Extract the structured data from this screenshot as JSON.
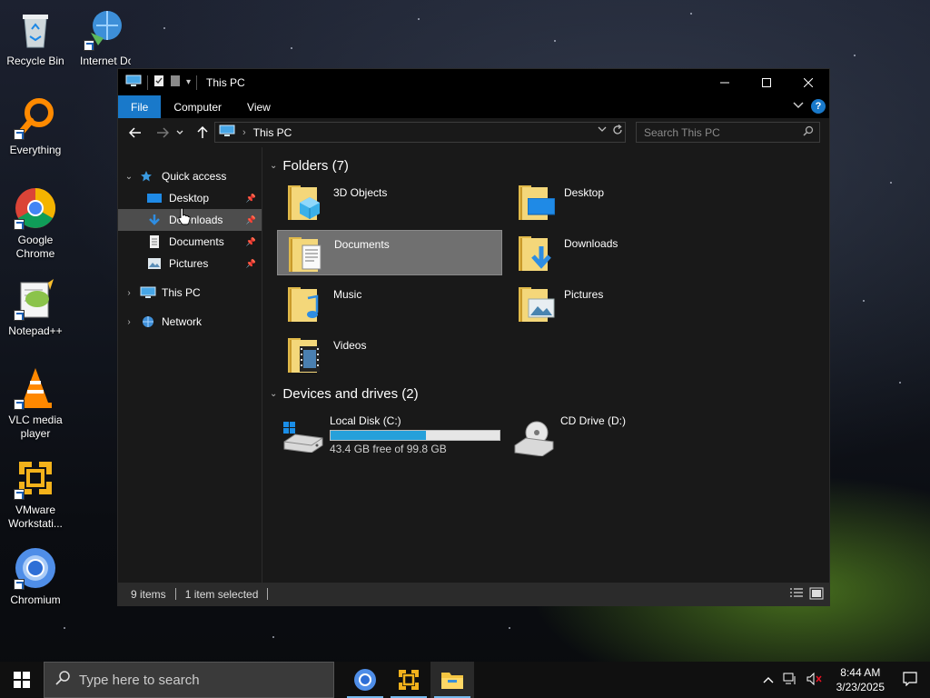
{
  "desktop": {
    "icons": [
      {
        "label": "Recycle Bin"
      },
      {
        "label": "Internet Downl"
      },
      {
        "label": "Everything"
      },
      {
        "label": "Google Chrome"
      },
      {
        "label": "Notepad++"
      },
      {
        "label": "VLC media player"
      },
      {
        "label": "VMware Workstati..."
      },
      {
        "label": "Chromium"
      }
    ]
  },
  "window": {
    "title": "This PC",
    "ribbon": {
      "tabs": [
        {
          "label": "File"
        },
        {
          "label": "Computer"
        },
        {
          "label": "View"
        }
      ]
    },
    "address": {
      "location": "This PC"
    },
    "search": {
      "placeholder": "Search This PC"
    },
    "nav": {
      "quick_access": "Quick access",
      "pinned": [
        {
          "label": "Desktop"
        },
        {
          "label": "Downloads"
        },
        {
          "label": "Documents"
        },
        {
          "label": "Pictures"
        }
      ],
      "this_pc": "This PC",
      "network": "Network"
    },
    "content": {
      "folders_heading": "Folders (7)",
      "folders": [
        {
          "name": "3D Objects"
        },
        {
          "name": "Desktop"
        },
        {
          "name": "Documents"
        },
        {
          "name": "Downloads"
        },
        {
          "name": "Music"
        },
        {
          "name": "Pictures"
        },
        {
          "name": "Videos"
        }
      ],
      "drives_heading": "Devices and drives (2)",
      "drives": [
        {
          "name": "Local Disk (C:)",
          "free_text": "43.4 GB free of 99.8 GB",
          "used_fraction": 0.565
        },
        {
          "name": "CD Drive (D:)"
        }
      ]
    },
    "status": {
      "items": "9 items",
      "selected": "1 item selected"
    }
  },
  "taskbar": {
    "search_placeholder": "Type here to search",
    "time": "8:44 AM",
    "date": "3/23/2025"
  },
  "colors": {
    "accent": "#1979ca",
    "selection": "#707070",
    "drive_fill": "#26a0da"
  }
}
